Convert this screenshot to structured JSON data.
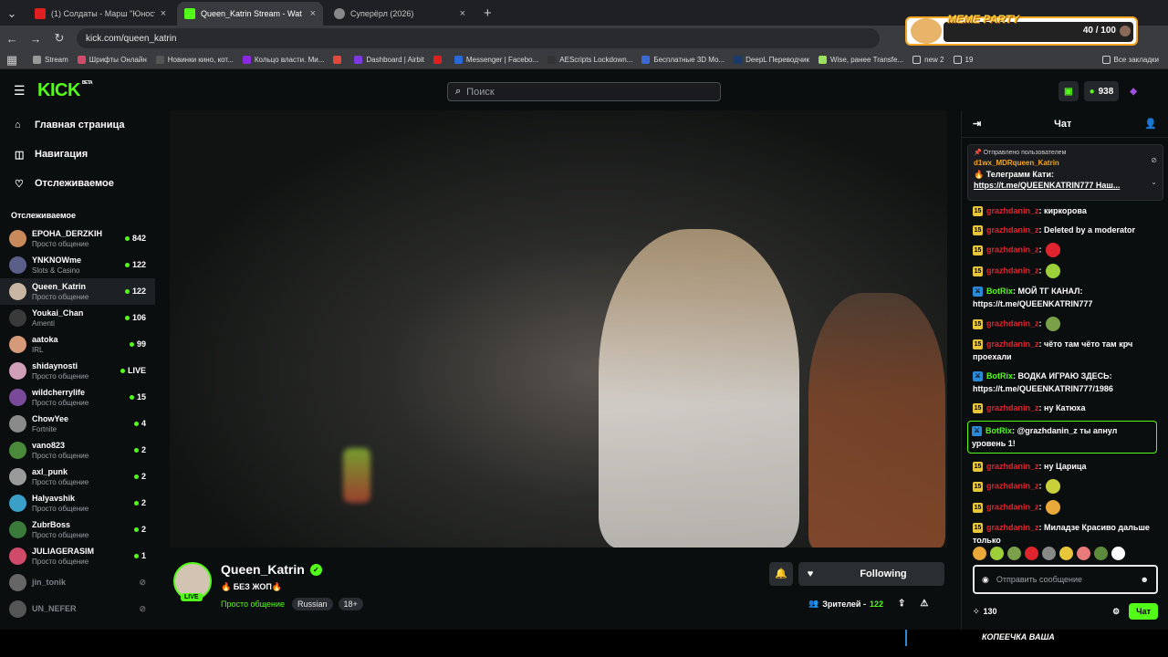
{
  "browser": {
    "tabs": [
      {
        "title": "(1) Солдаты - Марш \"Юность",
        "color": "#e02020"
      },
      {
        "title": "Queen_Katrin Stream - Wat",
        "color": "#53fc18"
      },
      {
        "title": "Суперёрл (2026)",
        "color": "#888888"
      }
    ],
    "url": "kick.com/queen_katrin",
    "bookmarks": [
      "Stream",
      "Шрифты Онлайн",
      "Новинки кино, кот...",
      "Кольцо власти. Ми...",
      "Dashboard | Airbit",
      "Messenger | Facebo...",
      "AEScripts Lockdown...",
      "Бесплатные 3D Мо...",
      "DeepL Переводчик",
      "Wise, ранее Transfe...",
      "new 2",
      "19",
      "Все закладки"
    ]
  },
  "overlay": {
    "meme_title": "MEME PARTY",
    "counter": "40 / 100"
  },
  "header": {
    "logo": "KICK",
    "beta": "BETA",
    "search_placeholder": "Поиск",
    "balance": "938"
  },
  "sidebar": {
    "nav": [
      {
        "label": "Главная страница",
        "icon": "home-icon"
      },
      {
        "label": "Навигация",
        "icon": "compass-icon"
      },
      {
        "label": "Отслеживаемое",
        "icon": "heart-icon"
      }
    ],
    "section_title": "Отслеживаемое",
    "following": [
      {
        "name": "EPOHA_DERZKIH",
        "category": "Просто общение",
        "viewers": "842",
        "color": "#c88a5a"
      },
      {
        "name": "YNKNOWme",
        "category": "Slots & Casino",
        "viewers": "122",
        "color": "#5a5f8a"
      },
      {
        "name": "Queen_Katrin",
        "category": "Просто общение",
        "viewers": "122",
        "color": "#c9b6a2"
      },
      {
        "name": "Youkai_Chan",
        "category": "Amenti",
        "viewers": "106",
        "color": "#3a3a3a"
      },
      {
        "name": "aatoka",
        "category": "IRL",
        "viewers": "99",
        "color": "#d49a7a"
      },
      {
        "name": "shidaynosti",
        "category": "Просто общение",
        "viewers": "LIVE",
        "color": "#d0a0b8"
      },
      {
        "name": "wildcherrylife",
        "category": "Просто общение",
        "viewers": "15",
        "color": "#7a4a9a"
      },
      {
        "name": "ChowYee",
        "category": "Fortnite",
        "viewers": "4",
        "color": "#8a8a8a"
      },
      {
        "name": "vano823",
        "category": "Просто общение",
        "viewers": "2",
        "color": "#4a8a3a"
      },
      {
        "name": "axl_punk",
        "category": "Просто общение",
        "viewers": "2",
        "color": "#9a9a9a"
      },
      {
        "name": "Halyavshik",
        "category": "Просто общение",
        "viewers": "2",
        "color": "#3aa0c8"
      },
      {
        "name": "ZubrBoss",
        "category": "Просто общение",
        "viewers": "2",
        "color": "#3a7a3a"
      },
      {
        "name": "JULIAGERASIM",
        "category": "Просто общение",
        "viewers": "1",
        "color": "#d04a6a"
      },
      {
        "name": "jin_tonik",
        "category": "",
        "viewers": "",
        "color": "#666666"
      },
      {
        "name": "UN_NEFER",
        "category": "",
        "viewers": "",
        "color": "#555555"
      }
    ]
  },
  "stream": {
    "channel": "Queen_Katrin",
    "live": "LIVE",
    "title": "🔥 БЕЗ ЖОП🔥",
    "category": "Просто общение",
    "tags": [
      "Russian",
      "18+"
    ],
    "follow_label": "Following",
    "viewers_label": "Зрителей -",
    "viewers": "122"
  },
  "chat": {
    "title": "Чат",
    "pinned_header": "Отправлено пользователем",
    "pinned_user": "d1wx_MDRqueen_Katrin",
    "pinned_line1": "🔥 Телеграмм Кати:",
    "pinned_line2": "https://t.me/QUEENKATRIN777 Наш...",
    "messages": [
      {
        "user": "grazhdanin_z",
        "text": ": киркорова",
        "bot": false,
        "badge": "15"
      },
      {
        "user": "grazhdanin_z",
        "text": ": Deleted by a moderator",
        "bot": false,
        "badge": "15"
      },
      {
        "user": "grazhdanin_z",
        "text": ":",
        "bot": false,
        "badge": "15",
        "emote": "#e0242e"
      },
      {
        "user": "grazhdanin_z",
        "text": ":",
        "bot": false,
        "badge": "15",
        "emote": "#9ccf3a"
      },
      {
        "user": "BotRix",
        "text": ": МОЙ ТГ КАНАЛ: https://t.me/QUEENKATRIN777",
        "bot": true,
        "badge": "⚔"
      },
      {
        "user": "grazhdanin_z",
        "text": ":",
        "bot": false,
        "badge": "15",
        "emote": "#7aa04a"
      },
      {
        "user": "grazhdanin_z",
        "text": ": чёто там чёто там крч проехали",
        "bot": false,
        "badge": "15"
      },
      {
        "user": "BotRix",
        "text": ": ВОДКА ИГРАЮ ЗДЕСЬ: https://t.me/QUEENKATRIN777/1986",
        "bot": true,
        "badge": "⚔"
      },
      {
        "user": "grazhdanin_z",
        "text": ": ну Катюха",
        "bot": false,
        "badge": "15"
      },
      {
        "user": "BotRix",
        "text": ": @grazhdanin_z ты апнул уровень 1!",
        "bot": true,
        "badge": "⚔",
        "highlight": true
      },
      {
        "user": "grazhdanin_z",
        "text": ": ну Царица",
        "bot": false,
        "badge": "15"
      },
      {
        "user": "grazhdanin_z",
        "text": ":",
        "bot": false,
        "badge": "15",
        "emote": "#c8d03a"
      },
      {
        "user": "grazhdanin_z",
        "text": ":",
        "bot": false,
        "badge": "15",
        "emote": "#e8a83a"
      },
      {
        "user": "grazhdanin_z",
        "text": ": Миладзе Красиво дальше только",
        "bot": false,
        "badge": "15"
      }
    ],
    "emote_colors": [
      "#e8a83a",
      "#9ccf3a",
      "#7aa04a",
      "#e0242e",
      "#888888",
      "#e8c63a",
      "#e87a7a",
      "#5a8a3a",
      "#ffffff"
    ],
    "input_placeholder": "Отправить сообщение",
    "points": "130",
    "send_label": "Чат"
  },
  "bottom_overlay": "КОПЕЕЧКА ВАША"
}
